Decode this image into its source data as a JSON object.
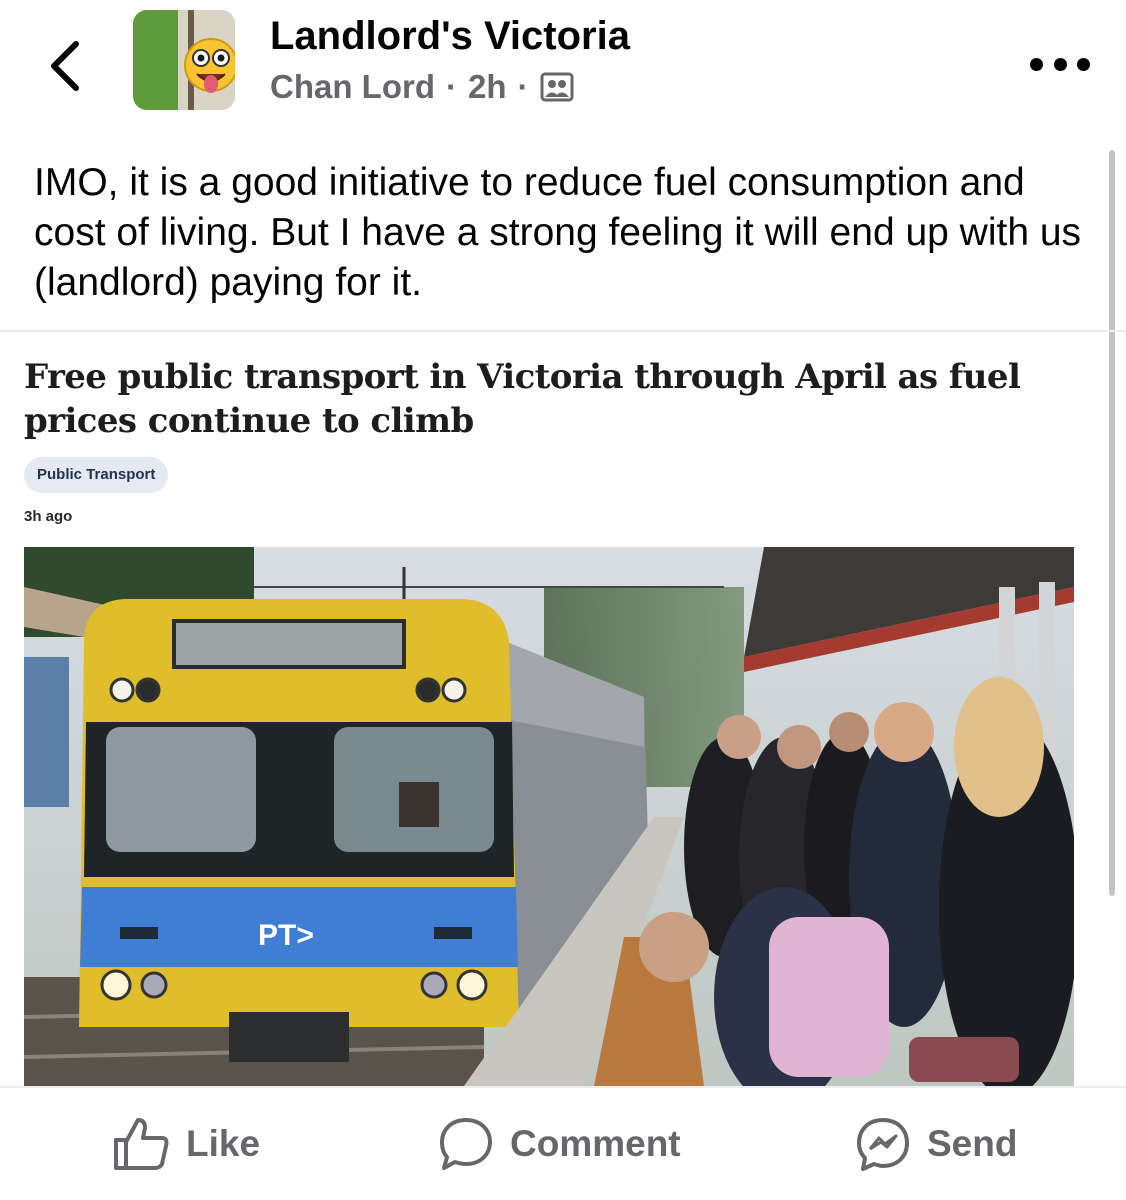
{
  "header": {
    "group_name": "Landlord's Victoria",
    "author": "Chan Lord",
    "separator": "·",
    "time_ago": "2h",
    "audience_icon": "group-icon",
    "back_icon": "back-chevron-icon",
    "more_icon": "more-horizontal-icon"
  },
  "post": {
    "text": "IMO, it is a good initiative to reduce fuel consumption and cost of living. But I have a strong feeling it will end up with us (landlord) paying for it."
  },
  "article": {
    "title": "Free public transport in Victoria through April as fuel prices continue to climb",
    "tag": "Public Transport",
    "time_ago": "3h ago",
    "photo_text": "PT>"
  },
  "actions": {
    "like_label": "Like",
    "comment_label": "Comment",
    "send_label": "Send"
  },
  "colors": {
    "text_primary": "#050505",
    "text_secondary": "#65676b",
    "tag_bg": "#e4e9f2",
    "train_yellow": "#e8c42a",
    "train_blue": "#3e7ed2"
  }
}
